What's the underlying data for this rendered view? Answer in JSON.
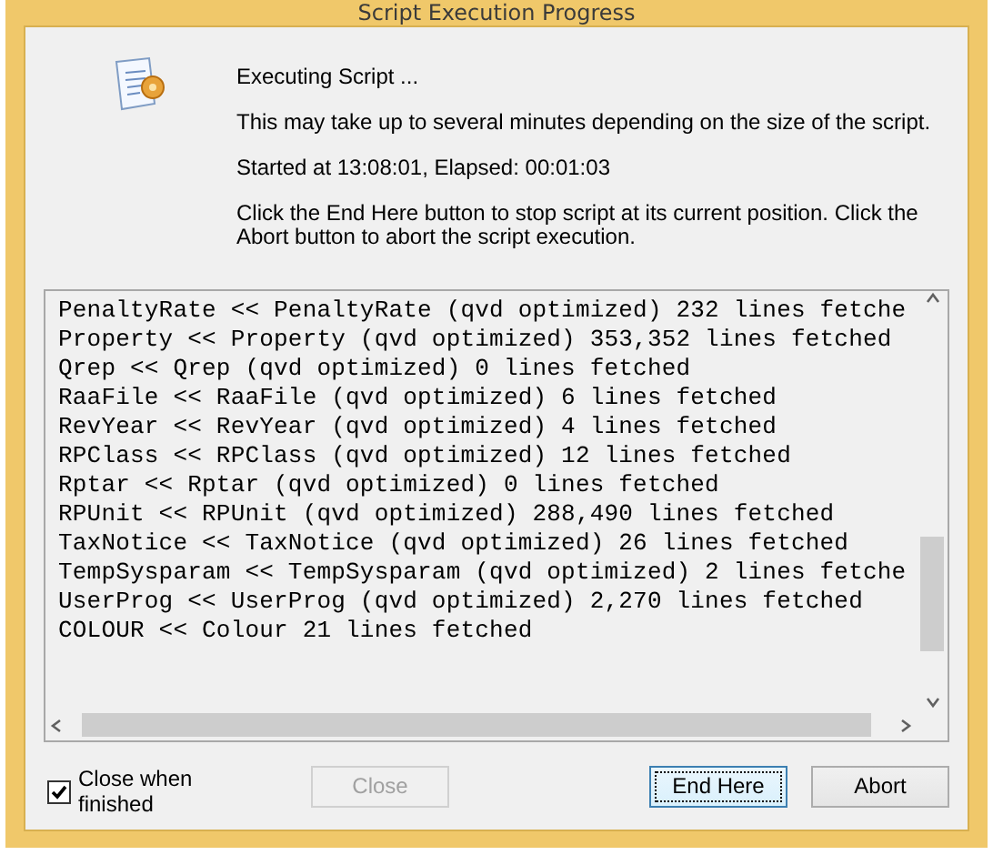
{
  "window": {
    "title": "Script Execution Progress"
  },
  "messages": [
    "Executing Script ...",
    "This may take up to several minutes depending on the size of the script.",
    "Started at 13:08:01, Elapsed: 00:01:03",
    "Click the End Here button to stop script at its current position. Click the Abort button to abort the script execution."
  ],
  "log": [
    "PenaltyRate << PenaltyRate (qvd optimized) 232 lines fetche",
    "Property << Property (qvd optimized) 353,352 lines fetched",
    "Qrep << Qrep (qvd optimized) 0 lines fetched",
    "RaaFile << RaaFile (qvd optimized) 6 lines fetched",
    "RevYear << RevYear (qvd optimized) 4 lines fetched",
    "RPClass << RPClass (qvd optimized) 12 lines fetched",
    "Rptar << Rptar (qvd optimized) 0 lines fetched",
    "RPUnit << RPUnit (qvd optimized) 288,490 lines fetched",
    "TaxNotice << TaxNotice (qvd optimized) 26 lines fetched",
    "TempSysparam << TempSysparam (qvd optimized) 2 lines fetche",
    "UserProg << UserProg (qvd optimized) 2,270 lines fetched",
    "COLOUR << Colour 21 lines fetched"
  ],
  "close_when_finished": {
    "label": "Close when finished",
    "checked": true
  },
  "buttons": [
    {
      "label": "Close",
      "disabled": true,
      "focused": false
    },
    {
      "label": "End Here",
      "disabled": false,
      "focused": true
    },
    {
      "label": "Abort",
      "disabled": false,
      "focused": false
    }
  ]
}
